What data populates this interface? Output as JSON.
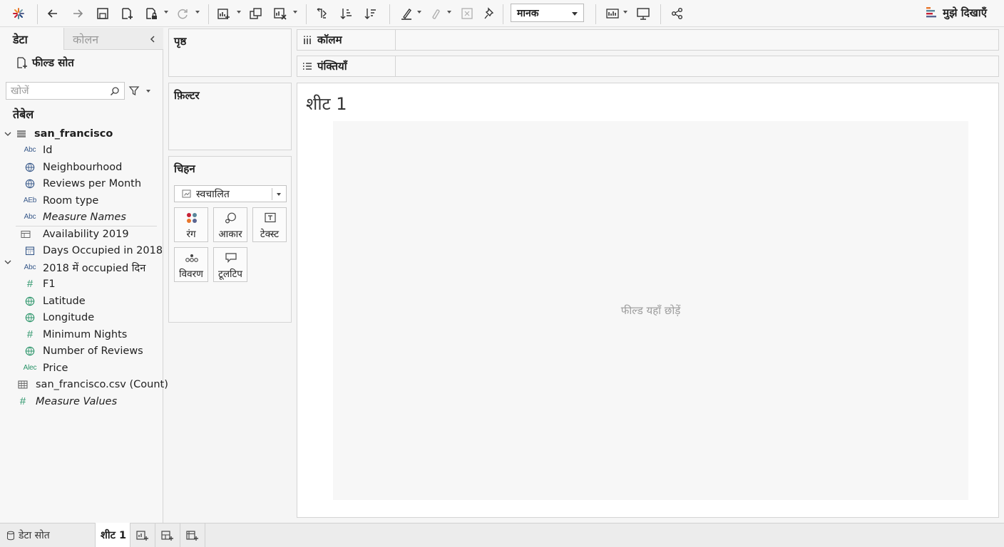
{
  "toolbar": {
    "mark_type_select": "मानक",
    "show_me": "मुझे दिखाएँ"
  },
  "data_pane": {
    "tab_data": "डेटा",
    "tab_analytics": "कोलन",
    "field_source": "फील्ड सोत",
    "search_placeholder": "खोजें",
    "tables_heading": "तेबेल",
    "table_name": "san_francisco",
    "fields": [
      {
        "icon": "Abc",
        "label": "Id"
      },
      {
        "icon": "globe",
        "label": "Neighbourhood"
      },
      {
        "icon": "globe",
        "label": "Reviews per Month"
      },
      {
        "icon": "AEb",
        "label": "Room type"
      },
      {
        "icon": "Abc",
        "label": "Measure Names"
      },
      {
        "icon": "table",
        "label": "Availability 2019"
      },
      {
        "icon": "calendar",
        "label": "Days Occupied in 2018"
      },
      {
        "icon": "Abc",
        "label": "2018 में occupied दिन"
      },
      {
        "icon": "#",
        "label": "F1"
      },
      {
        "icon": "globe",
        "label": "Latitude"
      },
      {
        "icon": "globe",
        "label": "Longitude"
      },
      {
        "icon": "#",
        "label": "Minimum Nights"
      },
      {
        "icon": "globe",
        "label": "Number of Reviews"
      },
      {
        "icon": "Alec",
        "label": "Price"
      },
      {
        "icon": "grid",
        "label": "san_francisco.csv (Count)"
      },
      {
        "icon": "#",
        "label": "Measure Values"
      }
    ]
  },
  "cards": {
    "pages": "पृष्ठ",
    "filters": "फ़िल्टर",
    "marks": "चिहन",
    "marks_type": "स्वचालित",
    "mark_buttons": [
      "रंग",
      "आकार",
      "टेक्स्ट",
      "विवरण",
      "टूलटिप"
    ]
  },
  "shelves": {
    "columns": "कॉलम",
    "rows": "पंक्तियाँ"
  },
  "view": {
    "sheet_title": "शीट 1",
    "drop_hint": "फील्ड यहाँ छोड़ें"
  },
  "tabbar": {
    "data_source": "डेटा सोत",
    "sheet1": "शीट 1"
  },
  "colors": {
    "measure_green": "#2a9469",
    "dimension_blue": "#38598a",
    "toolbar_bg": "#f7f7f7",
    "view_drop_bg": "#f7f7f7"
  }
}
